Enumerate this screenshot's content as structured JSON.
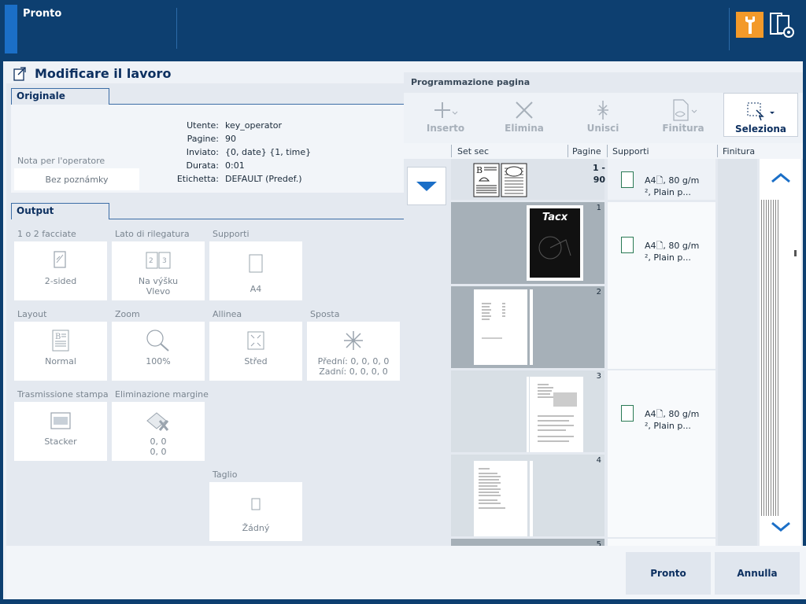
{
  "topbar": {
    "status": "Pronto"
  },
  "title": "Modificare il lavoro",
  "original": {
    "tab": "Originale",
    "note_label": "Nota per l'operatore",
    "note_value": "Bez poznámky",
    "info": [
      {
        "key": "Utente:",
        "value": "key_operator"
      },
      {
        "key": "Pagine:",
        "value": "90"
      },
      {
        "key": "Inviato:",
        "value": "{0, date} {1, time}"
      },
      {
        "key": "Durata:",
        "value": "0:01"
      },
      {
        "key": "Etichetta:",
        "value": "DEFAULT (Predef.)"
      }
    ]
  },
  "output": {
    "tab": "Output",
    "tiles": [
      {
        "label": "1 o 2 facciate",
        "value": "2-sided",
        "value2": "",
        "icon": "duplex-icon"
      },
      {
        "label": "Lato di rilegatura",
        "value": "Na výšku",
        "value2": "Vlevo",
        "icon": "binding-icon"
      },
      {
        "label": "Supporti",
        "value": "A4",
        "value2": "",
        "icon": "media-icon"
      },
      {
        "label": "Layout",
        "value": "Normal",
        "value2": "",
        "icon": "layout-icon"
      },
      {
        "label": "Zoom",
        "value": "100%",
        "value2": "",
        "icon": "zoom-icon"
      },
      {
        "label": "Allinea",
        "value": "Střed",
        "value2": "",
        "icon": "align-icon"
      },
      {
        "label": "Sposta",
        "value": "Přední: 0, 0, 0, 0",
        "value2": "Zadní: 0, 0, 0, 0",
        "icon": "shift-icon"
      },
      {
        "label": "Trasmissione stampa",
        "value": "Stacker",
        "value2": "",
        "icon": "stacker-icon"
      },
      {
        "label": "Eliminazione margine",
        "value": "0, 0",
        "value2": "0, 0",
        "icon": "erase-margin-icon"
      },
      {
        "label": "Taglio",
        "value": "Žádný",
        "value2": "",
        "icon": "trim-icon"
      }
    ]
  },
  "page_programming": {
    "title": "Programmazione pagina",
    "toolbar": [
      {
        "label": "Inserto",
        "icon": "insert-icon",
        "selected": false
      },
      {
        "label": "Elimina",
        "icon": "delete-icon",
        "selected": false
      },
      {
        "label": "Unisci",
        "icon": "merge-icon",
        "selected": false
      },
      {
        "label": "Finitura",
        "icon": "finishing-icon",
        "selected": false
      },
      {
        "label": "Seleziona",
        "icon": "select-icon",
        "selected": true
      }
    ],
    "columns": [
      "Set sec",
      "Pagine",
      "Supporti",
      "Finitura"
    ],
    "set_row": {
      "pages_line1": "1 -",
      "pages_line2": "90"
    },
    "media_line1": "A4",
    "media_line1b": ", 80 g/m",
    "media_line2": "², Plain p...",
    "page_numbers": [
      "1",
      "2",
      "3",
      "4",
      "5"
    ],
    "cover_text": "Tacx"
  },
  "actions": {
    "ok": "Pronto",
    "cancel": "Annulla"
  },
  "colors": {
    "accent": "#f39a2a",
    "header": "#0d3f70",
    "title": "#0d3060"
  }
}
